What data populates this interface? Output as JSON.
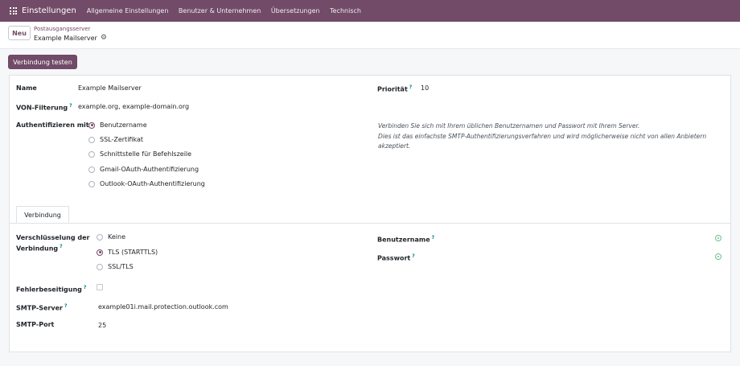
{
  "topbar": {
    "app_name": "Einstellungen",
    "menu": [
      "Allgemeine Einstellungen",
      "Benutzer & Unternehmen",
      "Übersetzungen",
      "Technisch"
    ]
  },
  "control_panel": {
    "new_button": "Neu",
    "breadcrumb_parent": "Postausgangsserver",
    "breadcrumb_current": "Example Mailserver"
  },
  "actions": {
    "test_connection": "Verbindung testen"
  },
  "form": {
    "name_label": "Name",
    "name_value": "Example Mailserver",
    "priority_label": "Priorität",
    "priority_value": "10",
    "from_filter_label": "VON-Filterung",
    "from_filter_value": "example.org, example-domain.org",
    "auth_label": "Authentifizieren mit",
    "auth_options": [
      {
        "label": "Benutzername",
        "selected": true
      },
      {
        "label": "SSL-Zertifikat",
        "selected": false
      },
      {
        "label": "Schnittstelle für Befehlszeile",
        "selected": false
      },
      {
        "label": "Gmail-OAuth-Authentifizierung",
        "selected": false
      },
      {
        "label": "Outlook-OAuth-Authentifizierung",
        "selected": false
      }
    ],
    "auth_help_1": "Verbinden Sie sich mit Ihrem üblichen Benutzernamen und Passwort mit Ihrem Server.",
    "auth_help_2": "Dies ist das einfachste SMTP-Authentifizierungsverfahren und wird möglicherweise nicht von allen Anbietern",
    "auth_help_3": "akzeptiert."
  },
  "tabs": {
    "connection": "Verbindung"
  },
  "connection": {
    "encryption_label_1": "Verschlüsselung der",
    "encryption_label_2": "Verbindung",
    "encryption_options": [
      {
        "label": "Keine",
        "selected": false
      },
      {
        "label": "TLS (STARTTLS)",
        "selected": true
      },
      {
        "label": "SSL/TLS",
        "selected": false
      }
    ],
    "username_label": "Benutzername",
    "password_label": "Passwort",
    "debug_label": "Fehlerbeseitigung",
    "debug_checked": false,
    "smtp_server_label": "SMTP-Server",
    "smtp_server_value": "example01i.mail.protection.outlook.com",
    "smtp_port_label": "SMTP-Port",
    "smtp_port_value": "25",
    "help_marker": "?"
  },
  "colors": {
    "brand": "#714b67",
    "accent": "#017e84"
  }
}
